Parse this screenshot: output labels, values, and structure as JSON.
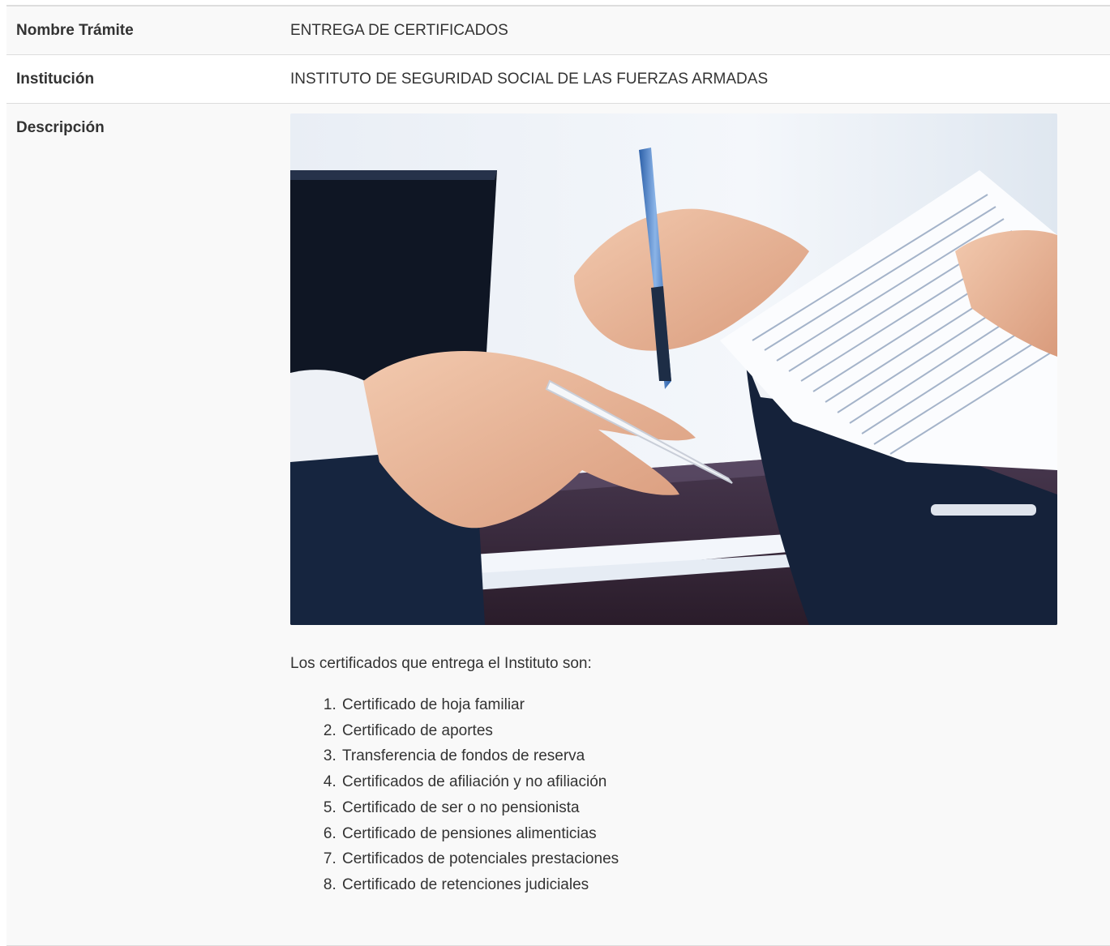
{
  "rows": {
    "nombre": {
      "label": "Nombre Trámite",
      "value": "ENTREGA DE CERTIFICADOS"
    },
    "institucion": {
      "label": "Institución",
      "value": "INSTITUTO DE SEGURIDAD SOCIAL DE LAS FUERZAS ARMADAS"
    },
    "descripcion": {
      "label": "Descripción",
      "image_alt": "business-handshake-documents-photo",
      "intro": "Los certificados que entrega el Instituto son:",
      "items": [
        "Certificado de hoja familiar",
        "Certificado de aportes",
        "Transferencia de fondos de reserva",
        "Certificados de afiliación y no afiliación",
        "Certificado de ser o no pensionista",
        "Certificado de pensiones alimenticias",
        "Certificados de potenciales prestaciones",
        "Certificado de retenciones judiciales"
      ]
    }
  },
  "colors": {
    "row_bg": "#f9f9f9",
    "border": "#dddddd",
    "text": "#333333"
  }
}
